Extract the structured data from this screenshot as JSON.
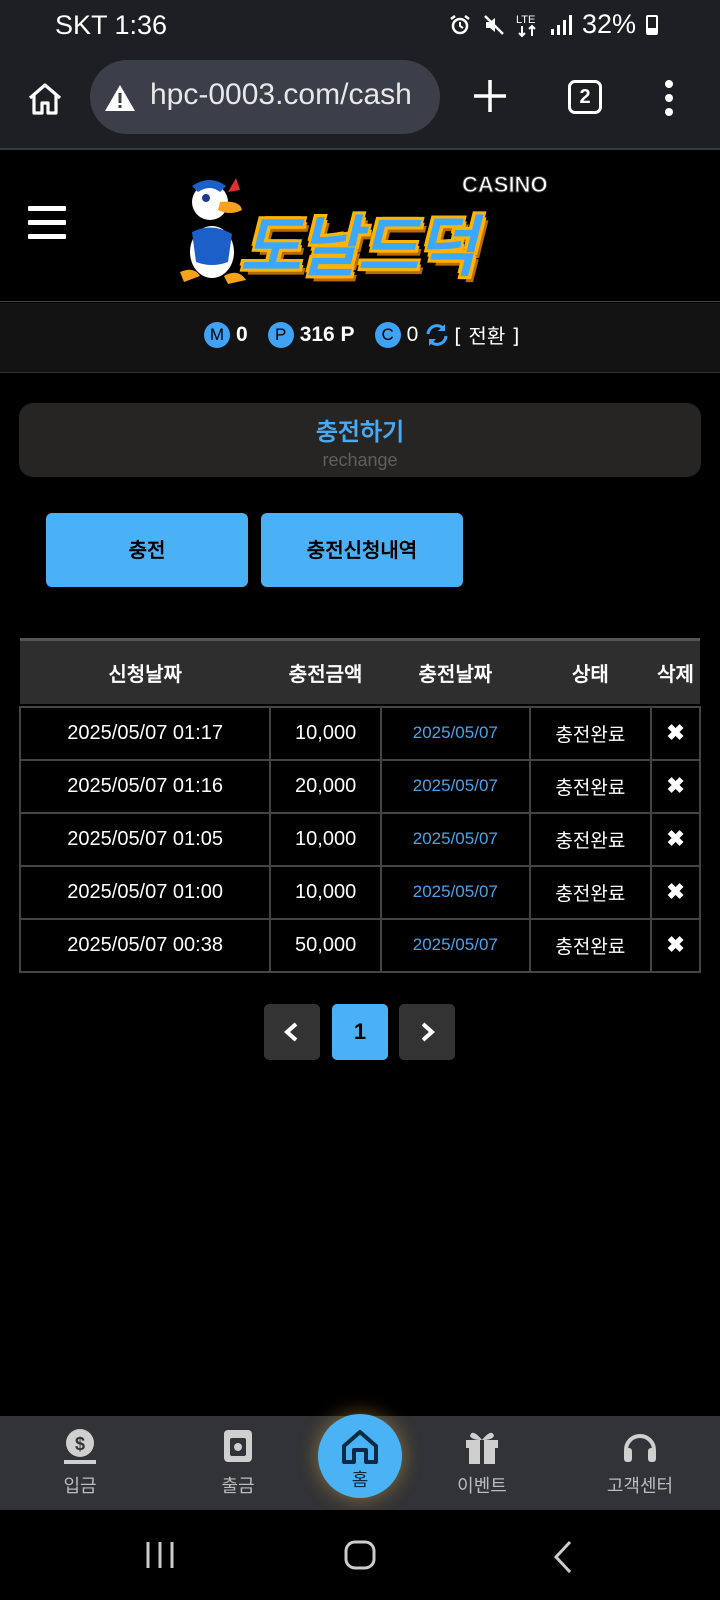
{
  "status_bar": {
    "carrier_time": "SKT 1:36",
    "battery": "32%"
  },
  "browser": {
    "url": "hpc-0003.com/cash",
    "tab_count": "2"
  },
  "site": {
    "logo_badge": "CASINO",
    "logo_word": "도날드덕"
  },
  "points": {
    "m_label": "M",
    "m_value": "0",
    "p_label": "P",
    "p_value": "316 P",
    "c_label": "C",
    "c_value": "0",
    "convert_label": "[ 전환 ]"
  },
  "panel": {
    "title": "충전하기",
    "subtitle": "rechange"
  },
  "tabs": {
    "charge": "충전",
    "history": "충전신청내역"
  },
  "table": {
    "headers": [
      "신청날짜",
      "충전금액",
      "충전날짜",
      "상태",
      "삭제"
    ],
    "rows": [
      {
        "requested": "2025/05/07 01:17",
        "amount": "10,000",
        "charged": "2025/05/07",
        "status": "충전완료",
        "delete": "✖"
      },
      {
        "requested": "2025/05/07 01:16",
        "amount": "20,000",
        "charged": "2025/05/07",
        "status": "충전완료",
        "delete": "✖"
      },
      {
        "requested": "2025/05/07 01:05",
        "amount": "10,000",
        "charged": "2025/05/07",
        "status": "충전완료",
        "delete": "✖"
      },
      {
        "requested": "2025/05/07 01:00",
        "amount": "10,000",
        "charged": "2025/05/07",
        "status": "충전완료",
        "delete": "✖"
      },
      {
        "requested": "2025/05/07 00:38",
        "amount": "50,000",
        "charged": "2025/05/07",
        "status": "충전완료",
        "delete": "✖"
      }
    ]
  },
  "pagination": {
    "current": "1"
  },
  "bottom_nav": {
    "deposit": "입금",
    "withdraw": "출금",
    "home": "홈",
    "event": "이벤트",
    "support": "고객센터"
  },
  "colors": {
    "accent": "#4ab1f7",
    "background": "#000000",
    "nav": "#323336"
  }
}
